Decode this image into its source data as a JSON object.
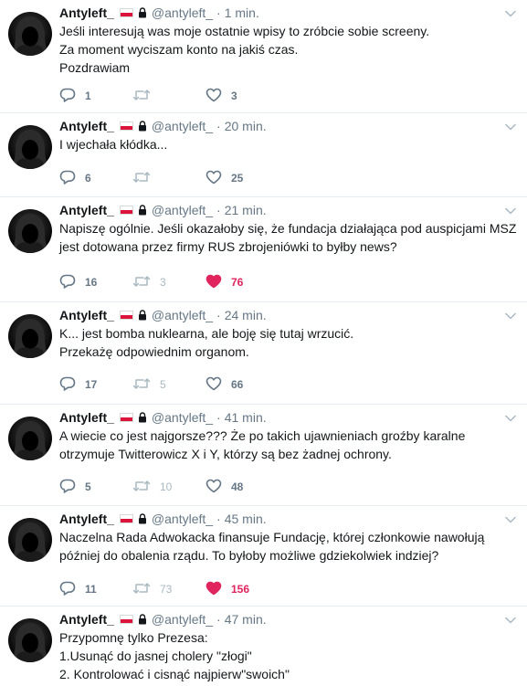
{
  "account": {
    "name": "Antyleft_",
    "handle": "@antyleft_"
  },
  "colors": {
    "like_active": "#e0245e",
    "icon_grey": "#657786",
    "retweet_disabled": "#aab8c2",
    "flag_red": "#dc143c"
  },
  "icons": {
    "reply": "reply-icon",
    "retweet": "retweet-icon",
    "like": "heart-icon",
    "protected": "lock-icon",
    "more": "chevron-down-icon"
  },
  "tweets": [
    {
      "time": "1 min.",
      "lines": [
        "Jeśli interesują was moje ostatnie wpisy to zróbcie sobie screeny.",
        "Za moment wyciszam konto na jakiś czas.",
        "Pozdrawiam"
      ],
      "replies": "1",
      "retweets": "",
      "likes": "3",
      "liked": false
    },
    {
      "time": "20 min.",
      "lines": [
        "I wjechała kłódka..."
      ],
      "replies": "6",
      "retweets": "",
      "likes": "25",
      "liked": false
    },
    {
      "time": "21 min.",
      "lines": [
        "Napiszę ogólnie. Jeśli okazałoby się, że fundacja działająca pod auspicjami MSZ",
        "jest dotowana przez firmy RUS zbrojeniówki to byłby news?"
      ],
      "replies": "16",
      "retweets": "3",
      "likes": "76",
      "liked": true
    },
    {
      "time": "24 min.",
      "lines": [
        "K... jest bomba nuklearna, ale boję się tutaj wrzucić.",
        "Przekażę odpowiednim organom."
      ],
      "replies": "17",
      "retweets": "5",
      "likes": "66",
      "liked": false
    },
    {
      "time": "41 min.",
      "lines": [
        "A wiecie co jest najgorsze??? Że po takich ujawnieniach groźby karalne",
        "otrzymuje Twitterowicz X i Y, którzy są bez żadnej ochrony."
      ],
      "replies": "5",
      "retweets": "10",
      "likes": "48",
      "liked": false
    },
    {
      "time": "45 min.",
      "lines": [
        "Naczelna Rada Adwokacka finansuje Fundację, której członkowie nawołują",
        "później do obalenia rządu. To byłoby możliwe gdziekolwiek indziej?"
      ],
      "replies": "11",
      "retweets": "73",
      "likes": "156",
      "liked": true
    },
    {
      "time": "47 min.",
      "lines": [
        "Przypomnę tylko Prezesa:",
        "1.Usunąć do jasnej cholery \"złogi\"",
        "2. Kontrolować i cisnąć najpierw\"swoich\""
      ],
      "replies": "",
      "retweets": "",
      "likes": "",
      "liked": false
    }
  ]
}
